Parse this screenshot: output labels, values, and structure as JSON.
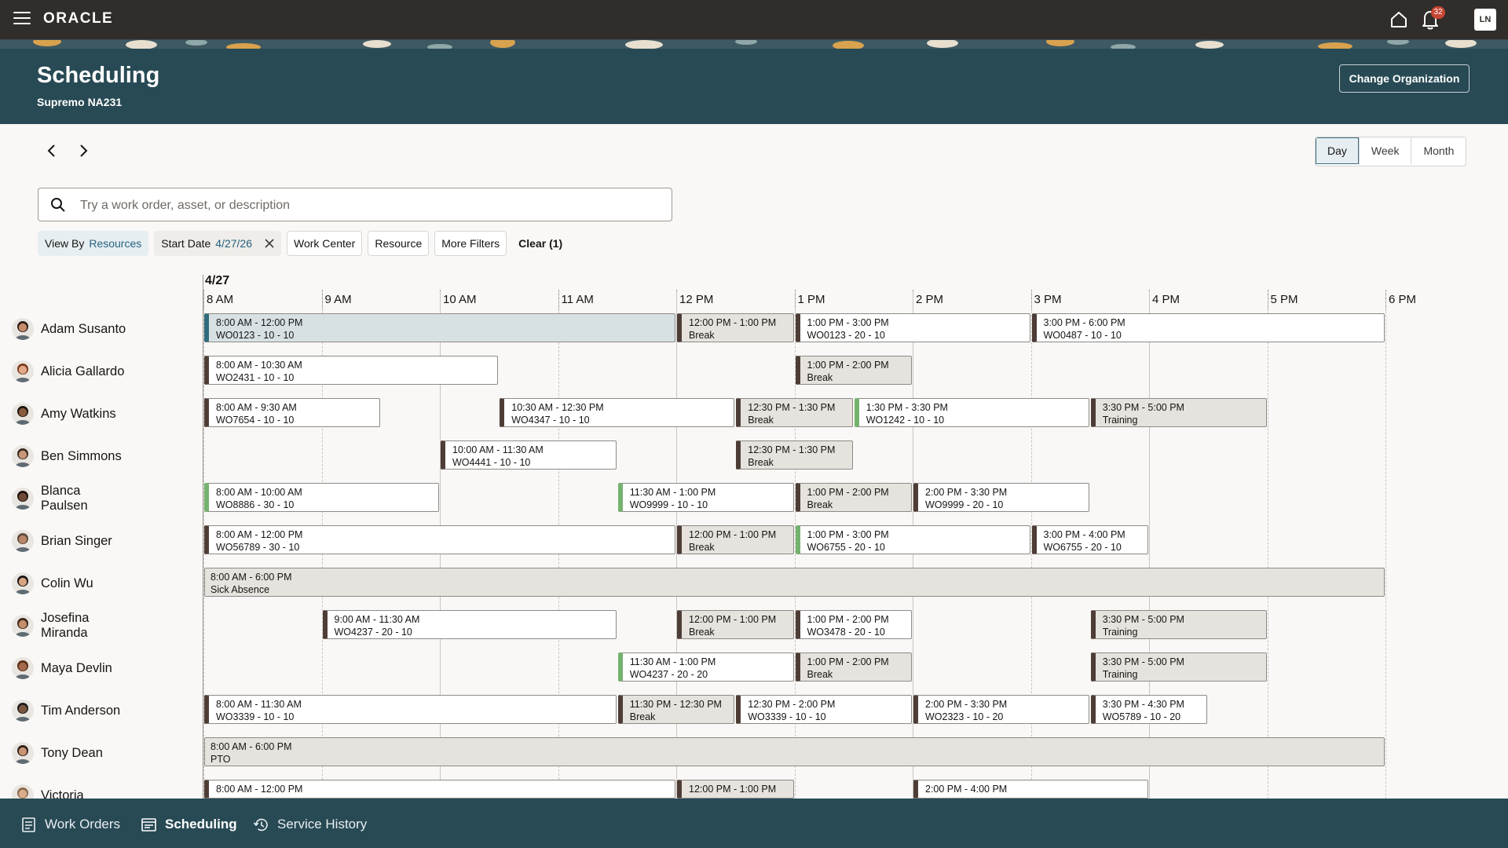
{
  "app": {
    "logo_text": "ORACLE",
    "notification_count": "32",
    "user_initials": "LN"
  },
  "header": {
    "title": "Scheduling",
    "subtitle": "Supremo NA231",
    "change_org_label": "Change Organization"
  },
  "view_switch": {
    "options": [
      "Day",
      "Week",
      "Month"
    ],
    "selected": "Day"
  },
  "search": {
    "placeholder": "Try a work order, asset, or description"
  },
  "filters": {
    "view_by_label": "View By",
    "view_by_value": "Resources",
    "start_date_label": "Start Date",
    "start_date_value": "4/27/26",
    "work_center": "Work Center",
    "resource": "Resource",
    "more_filters": "More Filters",
    "clear": "Clear (1)"
  },
  "timeline": {
    "date": "4/27",
    "hours": [
      "8 AM",
      "9 AM",
      "10 AM",
      "11 AM",
      "12 PM",
      "1 PM",
      "2 PM",
      "3 PM",
      "4 PM",
      "5 PM",
      "6 PM"
    ]
  },
  "resources": [
    {
      "name": "Adam Susanto",
      "events": [
        {
          "time": "8:00 AM - 12:00 PM",
          "detail": "WO0123 - 10 - 10",
          "start": 8,
          "end": 12,
          "kind": "selected"
        },
        {
          "time": "12:00 PM - 1:00 PM",
          "detail": "Break",
          "start": 12,
          "end": 13,
          "kind": "break"
        },
        {
          "time": "1:00 PM -  3:00 PM",
          "detail": "WO0123 - 20 - 10",
          "start": 13,
          "end": 15,
          "kind": "work"
        },
        {
          "time": "3:00 PM -  6:00 PM",
          "detail": "WO0487 - 10 - 10",
          "start": 15,
          "end": 18,
          "kind": "work"
        }
      ]
    },
    {
      "name": "Alicia Gallardo",
      "events": [
        {
          "time": "8:00 AM - 10:30 AM",
          "detail": "WO2431 - 10 - 10",
          "start": 8,
          "end": 10.5,
          "kind": "work"
        },
        {
          "time": "1:00 PM - 2:00 PM",
          "detail": "Break",
          "start": 13,
          "end": 14,
          "kind": "break"
        }
      ]
    },
    {
      "name": "Amy Watkins",
      "events": [
        {
          "time": "8:00 AM - 9:30 AM",
          "detail": "WO7654 - 10 - 10",
          "start": 8,
          "end": 9.5,
          "kind": "work"
        },
        {
          "time": "10:30 AM - 12:30 PM",
          "detail": "WO4347 - 10 - 10",
          "start": 10.5,
          "end": 12.5,
          "kind": "work"
        },
        {
          "time": "12:30 PM - 1:30 PM",
          "detail": "Break",
          "start": 12.5,
          "end": 13.5,
          "kind": "break"
        },
        {
          "time": "1:30 PM - 3:30 PM",
          "detail": "WO1242 - 10 - 10",
          "start": 13.5,
          "end": 15.5,
          "kind": "green"
        },
        {
          "time": "3:30 PM - 5:00 PM",
          "detail": "Training",
          "start": 15.5,
          "end": 17,
          "kind": "break"
        }
      ]
    },
    {
      "name": "Ben Simmons",
      "events": [
        {
          "time": "10:00 AM - 11:30 AM",
          "detail": "WO4441 - 10 - 10",
          "start": 10,
          "end": 11.5,
          "kind": "work"
        },
        {
          "time": "12:30 PM - 1:30 PM",
          "detail": "Break",
          "start": 12.5,
          "end": 13.5,
          "kind": "break"
        }
      ]
    },
    {
      "name": "Blanca Paulsen",
      "events": [
        {
          "time": "8:00 AM - 10:00 AM",
          "detail": "WO8886 - 30 - 10",
          "start": 8,
          "end": 10,
          "kind": "green"
        },
        {
          "time": "11:30 AM - 1:00 PM",
          "detail": "WO9999 - 10 - 10",
          "start": 11.5,
          "end": 13,
          "kind": "green"
        },
        {
          "time": "1:00 PM - 2:00 PM",
          "detail": "Break",
          "start": 13,
          "end": 14,
          "kind": "break"
        },
        {
          "time": "2:00 PM - 3:30 PM",
          "detail": "WO9999 - 20 - 10",
          "start": 14,
          "end": 15.5,
          "kind": "work"
        }
      ]
    },
    {
      "name": "Brian Singer",
      "events": [
        {
          "time": "8:00 AM - 12:00 PM",
          "detail": "WO56789 - 30 - 10",
          "start": 8,
          "end": 12,
          "kind": "work"
        },
        {
          "time": "12:00 PM - 1:00 PM",
          "detail": "Break",
          "start": 12,
          "end": 13,
          "kind": "break"
        },
        {
          "time": "1:00 PM - 3:00 PM",
          "detail": "WO6755 - 20 - 10",
          "start": 13,
          "end": 15,
          "kind": "green"
        },
        {
          "time": "3:00 PM - 4:00 PM",
          "detail": "WO6755 - 20 - 10",
          "start": 15,
          "end": 16,
          "kind": "work"
        }
      ]
    },
    {
      "name": "Colin Wu",
      "events": [
        {
          "time": "8:00 AM - 6:00 PM",
          "detail": "Sick Absence",
          "start": 8,
          "end": 18,
          "kind": "absence"
        }
      ]
    },
    {
      "name": "Josefina Miranda",
      "events": [
        {
          "time": "9:00 AM - 11:30 AM",
          "detail": "WO4237 - 20 - 10",
          "start": 9,
          "end": 11.5,
          "kind": "work"
        },
        {
          "time": "12:00 PM - 1:00 PM",
          "detail": "Break",
          "start": 12,
          "end": 13,
          "kind": "break"
        },
        {
          "time": "1:00 PM - 2:00 PM",
          "detail": "WO3478 - 20 - 10",
          "start": 13,
          "end": 14,
          "kind": "work"
        },
        {
          "time": "3:30 PM - 5:00 PM",
          "detail": "Training",
          "start": 15.5,
          "end": 17,
          "kind": "break"
        }
      ]
    },
    {
      "name": "Maya Devlin",
      "events": [
        {
          "time": "11:30 AM - 1:00 PM",
          "detail": "WO4237 - 20 - 20",
          "start": 11.5,
          "end": 13,
          "kind": "green"
        },
        {
          "time": "1:00 PM - 2:00 PM",
          "detail": "Break",
          "start": 13,
          "end": 14,
          "kind": "break"
        },
        {
          "time": "3:30 PM - 5:00 PM",
          "detail": "Training",
          "start": 15.5,
          "end": 17,
          "kind": "break"
        }
      ]
    },
    {
      "name": "Tim Anderson",
      "events": [
        {
          "time": "8:00 AM - 11:30 AM",
          "detail": "WO3339 - 10 - 10",
          "start": 8,
          "end": 11.5,
          "kind": "work"
        },
        {
          "time": "11:30 PM - 12:30 PM",
          "detail": "Break",
          "start": 11.5,
          "end": 12.5,
          "kind": "break"
        },
        {
          "time": "12:30 PM - 2:00 PM",
          "detail": "WO3339 - 10 - 10",
          "start": 12.5,
          "end": 14,
          "kind": "work"
        },
        {
          "time": "2:00 PM - 3:30 PM",
          "detail": "WO2323 - 10 - 20",
          "start": 14,
          "end": 15.5,
          "kind": "work"
        },
        {
          "time": "3:30 PM - 4:30 PM",
          "detail": "WO5789 - 10 - 20",
          "start": 15.5,
          "end": 16.5,
          "kind": "work"
        }
      ]
    },
    {
      "name": "Tony Dean",
      "events": [
        {
          "time": "8:00 AM - 6:00 PM",
          "detail": "PTO",
          "start": 8,
          "end": 18,
          "kind": "absence"
        }
      ]
    },
    {
      "name": "Victoria",
      "events": [
        {
          "time": "8:00 AM - 12:00 PM",
          "detail": "",
          "start": 8,
          "end": 12,
          "kind": "work"
        },
        {
          "time": "12:00 PM - 1:00 PM",
          "detail": "",
          "start": 12,
          "end": 13,
          "kind": "break"
        },
        {
          "time": "2:00 PM -  4:00 PM",
          "detail": "",
          "start": 14,
          "end": 16,
          "kind": "work"
        }
      ]
    }
  ],
  "bottom_nav": [
    {
      "label": "Work Orders",
      "icon": "document-icon",
      "active": false
    },
    {
      "label": "Scheduling",
      "icon": "calendar-list-icon",
      "active": true
    },
    {
      "label": "Service History",
      "icon": "history-icon",
      "active": false
    }
  ]
}
